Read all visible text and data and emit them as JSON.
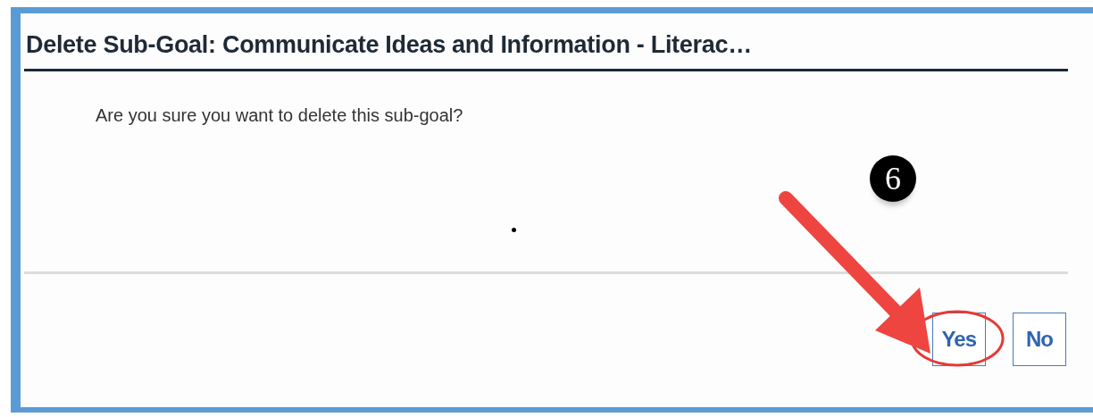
{
  "dialog": {
    "title": "Delete Sub-Goal: Communicate Ideas and Information - Literac…",
    "message": "Are you sure you want to delete this sub-goal?",
    "buttons": [
      {
        "label": "Yes",
        "circled": true
      },
      {
        "label": "No",
        "circled": false
      }
    ]
  },
  "annotation": {
    "step": "6"
  }
}
